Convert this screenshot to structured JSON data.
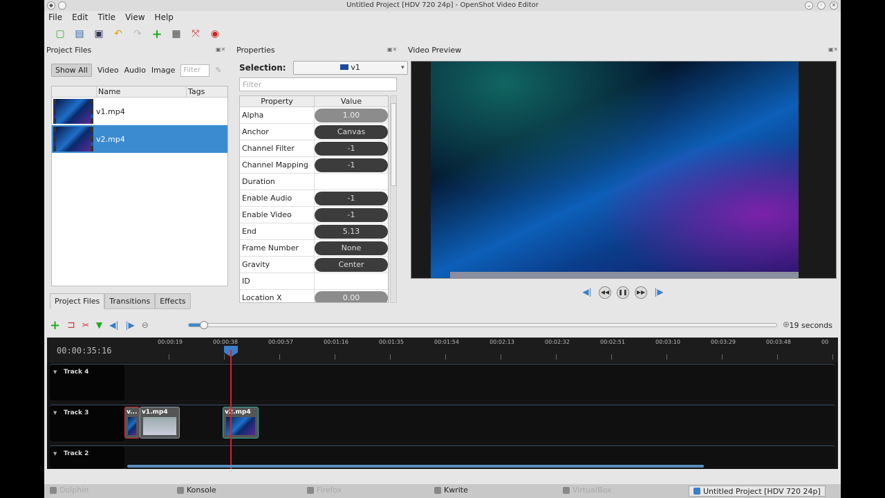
{
  "window": {
    "title": "Untitled Project [HDV 720 24p] - OpenShot Video Editor"
  },
  "menu": [
    "File",
    "Edit",
    "Title",
    "View",
    "Help"
  ],
  "project_files": {
    "title": "Project Files",
    "filters": [
      "Show All",
      "Video",
      "Audio",
      "Image"
    ],
    "filter_placeholder": "Filter",
    "columns": {
      "name": "Name",
      "tags": "Tags"
    },
    "files": [
      {
        "name": "v1.mp4"
      },
      {
        "name": "v2.mp4",
        "selected": true
      }
    ],
    "tabs": [
      "Project Files",
      "Transitions",
      "Effects"
    ]
  },
  "properties": {
    "title": "Properties",
    "selection_label": "Selection:",
    "selection_value": "v1",
    "filter_placeholder": "Filter",
    "columns": {
      "property": "Property",
      "value": "Value"
    },
    "rows": [
      {
        "name": "Alpha",
        "value": "1.00",
        "style": "light"
      },
      {
        "name": "Anchor",
        "value": "Canvas",
        "style": "dark"
      },
      {
        "name": "Channel Filter",
        "value": "-1",
        "style": "dark"
      },
      {
        "name": "Channel Mapping",
        "value": "-1",
        "style": "dark"
      },
      {
        "name": "Duration",
        "value": "",
        "style": "none"
      },
      {
        "name": "Enable Audio",
        "value": "-1",
        "style": "dark"
      },
      {
        "name": "Enable Video",
        "value": "-1",
        "style": "dark"
      },
      {
        "name": "End",
        "value": "5.13",
        "style": "dark"
      },
      {
        "name": "Frame Number",
        "value": "None",
        "style": "dark"
      },
      {
        "name": "Gravity",
        "value": "Center",
        "style": "dark"
      },
      {
        "name": "ID",
        "value": "",
        "style": "none"
      },
      {
        "name": "Location X",
        "value": "0.00",
        "style": "light"
      }
    ]
  },
  "preview": {
    "title": "Video Preview"
  },
  "timeline": {
    "duration_label": "19 seconds",
    "timecode": "00:00:35:16",
    "ticks": [
      "00:00:19",
      "00:00:38",
      "00:00:57",
      "00:01:16",
      "00:01:35",
      "00:01:54",
      "00:02:13",
      "00:02:32",
      "00:02:51",
      "00:03:10",
      "00:03:29",
      "00:03:48",
      "00"
    ],
    "tracks": [
      {
        "name": "Track 4",
        "clips": []
      },
      {
        "name": "Track 3",
        "clips": [
          {
            "label": "v..."
          },
          {
            "label": "v1.mp4"
          },
          {
            "label": "v2.mp4"
          }
        ]
      },
      {
        "name": "Track 2",
        "clips": []
      }
    ]
  },
  "taskbar": [
    "Dolphin",
    "Konsole",
    "Firefox",
    "Kwrite",
    "VirtualBox",
    "Untitled Project [HDV 720 24p]"
  ]
}
